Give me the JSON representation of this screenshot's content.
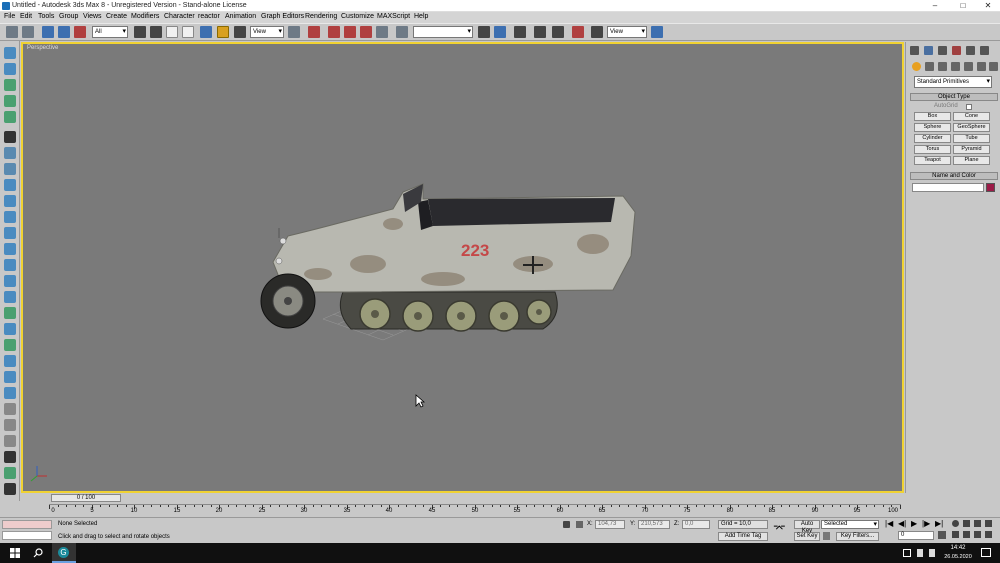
{
  "window": {
    "title": "Untitled - Autodesk 3ds Max 8 - Unregistered Version - Stand-alone License"
  },
  "menu": [
    "File",
    "Edit",
    "Tools",
    "Group",
    "Views",
    "Create",
    "Modifiers",
    "Character",
    "reactor",
    "Animation",
    "Graph Editors",
    "Rendering",
    "Customize",
    "MAXScript",
    "Help"
  ],
  "toolbar": {
    "selection_filter": "All",
    "ref_coord": "View",
    "named_selection": "",
    "render_type": "View"
  },
  "viewport": {
    "label": "Perspective",
    "vehicle_number": "223"
  },
  "command_panel": {
    "category": "Standard Primitives",
    "object_type_header": "Object Type",
    "autogrid": "AutoGrid",
    "buttons": [
      "Box",
      "Cone",
      "Sphere",
      "GeoSphere",
      "Cylinder",
      "Tube",
      "Torus",
      "Pyramid",
      "Teapot",
      "Plane"
    ],
    "name_color_header": "Name and Color",
    "name_value": "",
    "swatch_color": "#9b1b47"
  },
  "timeline": {
    "slider": "0 / 100",
    "ticks": [
      "0",
      "5",
      "10",
      "15",
      "20",
      "25",
      "30",
      "35",
      "40",
      "45",
      "50",
      "55",
      "60",
      "65",
      "70",
      "75",
      "80",
      "85",
      "90",
      "95",
      "100"
    ]
  },
  "status": {
    "selection": "None Selected",
    "prompt": "Click and drag to select and rotate objects",
    "x_label": "X:",
    "x_value": "104,73",
    "y_label": "Y:",
    "y_value": "210,573",
    "z_label": "Z:",
    "z_value": "0,0",
    "grid": "Grid = 10,0",
    "add_time_tag": "Add Time Tag",
    "auto_key": "Auto Key",
    "set_key": "Set Key",
    "key_mode": "Selected",
    "key_filters": "Key Filters...",
    "frame": "0"
  },
  "taskbar": {
    "time": "14:42",
    "date": "26.05.2020"
  },
  "colors": {
    "viewport_bg": "#7a7a7a",
    "active_border": "#f0d232",
    "taskbar": "#101010"
  }
}
